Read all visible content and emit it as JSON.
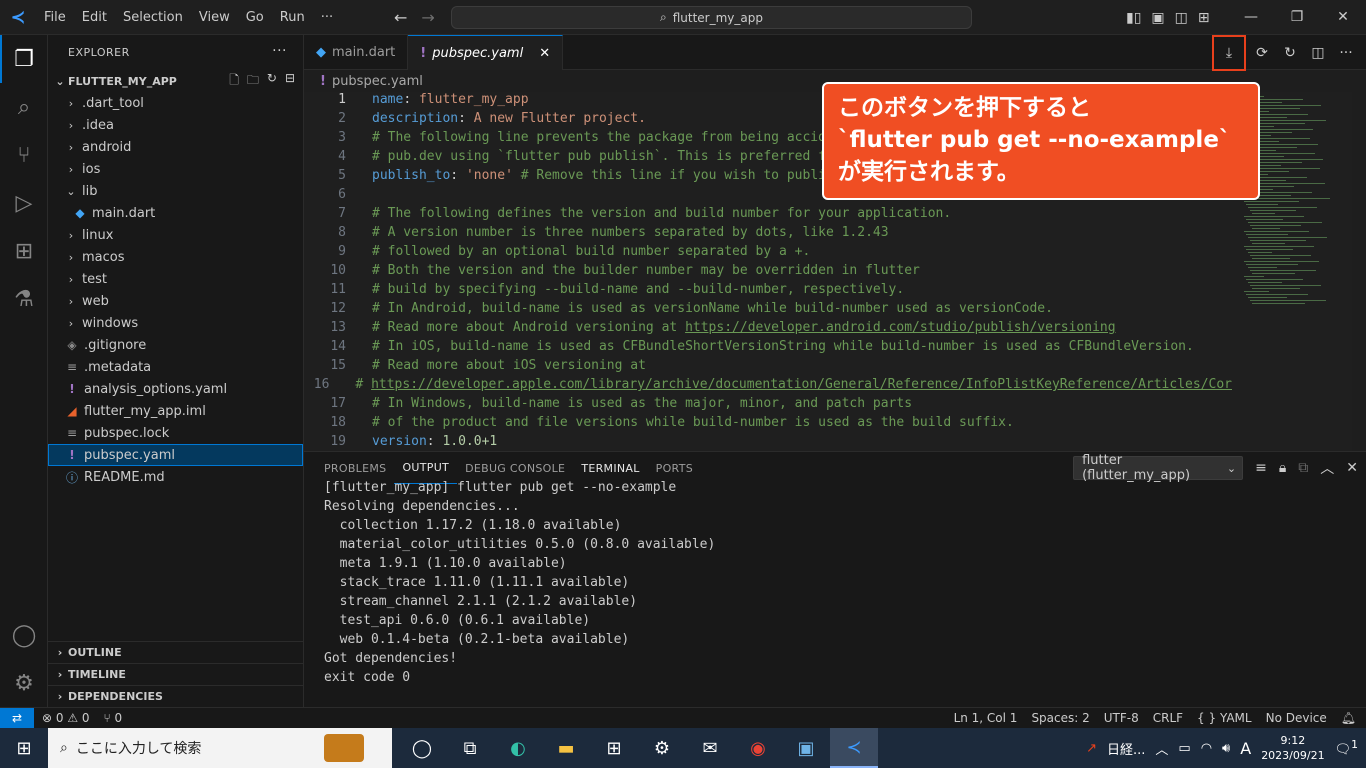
{
  "titlebar": {
    "menu": [
      "File",
      "Edit",
      "Selection",
      "View",
      "Go",
      "Run",
      "···"
    ],
    "search_text": "flutter_my_app"
  },
  "explorer": {
    "title": "EXPLORER",
    "project": "FLUTTER_MY_APP",
    "items": [
      {
        "label": ".dart_tool",
        "type": "folder",
        "indent": 0
      },
      {
        "label": ".idea",
        "type": "folder",
        "indent": 0
      },
      {
        "label": "android",
        "type": "folder",
        "indent": 0
      },
      {
        "label": "ios",
        "type": "folder",
        "indent": 0
      },
      {
        "label": "lib",
        "type": "folder-open",
        "indent": 0
      },
      {
        "label": "main.dart",
        "type": "dart",
        "indent": 1
      },
      {
        "label": "linux",
        "type": "folder",
        "indent": 0
      },
      {
        "label": "macos",
        "type": "folder",
        "indent": 0
      },
      {
        "label": "test",
        "type": "folder",
        "indent": 0
      },
      {
        "label": "web",
        "type": "folder",
        "indent": 0
      },
      {
        "label": "windows",
        "type": "folder",
        "indent": 0
      },
      {
        "label": ".gitignore",
        "type": "git",
        "indent": 0
      },
      {
        "label": ".metadata",
        "type": "lines",
        "indent": 0
      },
      {
        "label": "analysis_options.yaml",
        "type": "yaml",
        "indent": 0
      },
      {
        "label": "flutter_my_app.iml",
        "type": "rss",
        "indent": 0
      },
      {
        "label": "pubspec.lock",
        "type": "lines",
        "indent": 0
      },
      {
        "label": "pubspec.yaml",
        "type": "yaml",
        "indent": 0,
        "selected": true
      },
      {
        "label": "README.md",
        "type": "info",
        "indent": 0
      }
    ],
    "sections": [
      "OUTLINE",
      "TIMELINE",
      "DEPENDENCIES"
    ]
  },
  "tabs": [
    {
      "label": "main.dart",
      "active": false
    },
    {
      "label": "pubspec.yaml",
      "active": true
    }
  ],
  "breadcrumb": "pubspec.yaml",
  "editor_lines": [
    {
      "n": "1",
      "parts": [
        [
          "k",
          "name"
        ],
        [
          "p",
          ": "
        ],
        [
          "s",
          "flutter_my_app"
        ]
      ]
    },
    {
      "n": "2",
      "parts": [
        [
          "k",
          "description"
        ],
        [
          "p",
          ": "
        ],
        [
          "s",
          "A new Flutter project."
        ]
      ]
    },
    {
      "n": "3",
      "parts": [
        [
          "c",
          "# The following line prevents the package from being accide"
        ]
      ]
    },
    {
      "n": "4",
      "parts": [
        [
          "c",
          "# pub.dev using `flutter pub publish`. This is preferred fo"
        ]
      ]
    },
    {
      "n": "5",
      "parts": [
        [
          "k",
          "publish_to"
        ],
        [
          "p",
          ": "
        ],
        [
          "s",
          "'none'"
        ],
        [
          "c",
          " # Remove this line if you wish to publis"
        ]
      ]
    },
    {
      "n": "6",
      "parts": []
    },
    {
      "n": "7",
      "parts": [
        [
          "c",
          "# The following defines the version and build number for your application."
        ]
      ]
    },
    {
      "n": "8",
      "parts": [
        [
          "c",
          "# A version number is three numbers separated by dots, like 1.2.43"
        ]
      ]
    },
    {
      "n": "9",
      "parts": [
        [
          "c",
          "# followed by an optional build number separated by a +."
        ]
      ]
    },
    {
      "n": "10",
      "parts": [
        [
          "c",
          "# Both the version and the builder number may be overridden in flutter"
        ]
      ]
    },
    {
      "n": "11",
      "parts": [
        [
          "c",
          "# build by specifying --build-name and --build-number, respectively."
        ]
      ]
    },
    {
      "n": "12",
      "parts": [
        [
          "c",
          "# In Android, build-name is used as versionName while build-number used as versionCode."
        ]
      ]
    },
    {
      "n": "13",
      "parts": [
        [
          "c",
          "# Read more about Android versioning at "
        ],
        [
          "u",
          "https://developer.android.com/studio/publish/versioning"
        ]
      ]
    },
    {
      "n": "14",
      "parts": [
        [
          "c",
          "# In iOS, build-name is used as CFBundleShortVersionString while build-number is used as CFBundleVersion."
        ]
      ]
    },
    {
      "n": "15",
      "parts": [
        [
          "c",
          "# Read more about iOS versioning at"
        ]
      ]
    },
    {
      "n": "16",
      "parts": [
        [
          "c",
          "# "
        ],
        [
          "u",
          "https://developer.apple.com/library/archive/documentation/General/Reference/InfoPlistKeyReference/Articles/Cor"
        ]
      ]
    },
    {
      "n": "17",
      "parts": [
        [
          "c",
          "# In Windows, build-name is used as the major, minor, and patch parts"
        ]
      ]
    },
    {
      "n": "18",
      "parts": [
        [
          "c",
          "# of the product and file versions while build-number is used as the build suffix."
        ]
      ]
    },
    {
      "n": "19",
      "parts": [
        [
          "k",
          "version"
        ],
        [
          "p",
          ": "
        ],
        [
          "n",
          "1.0.0+1"
        ]
      ]
    }
  ],
  "annotation": {
    "line1": "このボタンを押下すると",
    "line2": "`flutter pub get --no-example`",
    "line3": "が実行されます。"
  },
  "panel": {
    "tabs": [
      "PROBLEMS",
      "OUTPUT",
      "DEBUG CONSOLE",
      "TERMINAL",
      "PORTS"
    ],
    "active_tab": "OUTPUT",
    "channel": "flutter (flutter_my_app)",
    "output_lines": [
      "[flutter_my_app] flutter pub get --no-example",
      "Resolving dependencies...",
      "  collection 1.17.2 (1.18.0 available)",
      "  material_color_utilities 0.5.0 (0.8.0 available)",
      "  meta 1.9.1 (1.10.0 available)",
      "  stack_trace 1.11.0 (1.11.1 available)",
      "  stream_channel 2.1.1 (2.1.2 available)",
      "  test_api 0.6.0 (0.6.1 available)",
      "  web 0.1.4-beta (0.2.1-beta available)",
      "Got dependencies!",
      "exit code 0"
    ]
  },
  "statusbar": {
    "errors": "⊗ 0 ⚠ 0",
    "ports": "⑂ 0",
    "position": "Ln 1, Col 1",
    "spaces": "Spaces: 2",
    "encoding": "UTF-8",
    "eol": "CRLF",
    "language": "{ } YAML",
    "device": "No Device"
  },
  "taskbar": {
    "search_placeholder": "ここに入力して検索",
    "news": "日経...",
    "ime": "A",
    "time": "9:12",
    "date": "2023/09/21",
    "notifications": "1"
  },
  "colors": {
    "accent": "#0078d4",
    "annotation": "#f04e23",
    "highlight_border": "#e8401c"
  }
}
